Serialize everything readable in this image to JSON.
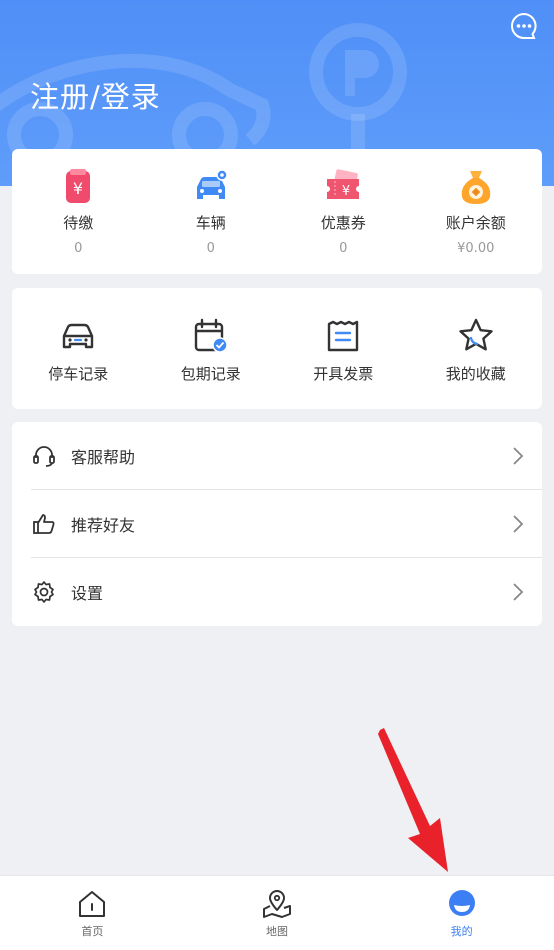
{
  "header": {
    "login_label": "注册/登录"
  },
  "stats": [
    {
      "label": "待缴",
      "value": "0",
      "icon": "pending-bill-icon"
    },
    {
      "label": "车辆",
      "value": "0",
      "icon": "car-location-icon"
    },
    {
      "label": "优惠券",
      "value": "0",
      "icon": "coupon-icon"
    },
    {
      "label": "账户余额",
      "value": "¥0.00",
      "icon": "money-bag-icon"
    }
  ],
  "records": [
    {
      "label": "停车记录",
      "icon": "car-icon"
    },
    {
      "label": "包期记录",
      "icon": "calendar-check-icon"
    },
    {
      "label": "开具发票",
      "icon": "invoice-icon"
    },
    {
      "label": "我的收藏",
      "icon": "star-icon"
    }
  ],
  "menu": [
    {
      "label": "客服帮助",
      "icon": "headset-icon"
    },
    {
      "label": "推荐好友",
      "icon": "thumbs-up-icon"
    },
    {
      "label": "设置",
      "icon": "gear-icon"
    }
  ],
  "tabs": [
    {
      "label": "首页",
      "icon": "home-icon",
      "active": false
    },
    {
      "label": "地图",
      "icon": "map-pin-icon",
      "active": false
    },
    {
      "label": "我的",
      "icon": "profile-icon",
      "active": true
    }
  ],
  "colors": {
    "header_blue": "#4f8ff7",
    "active_tab": "#3c7ff5",
    "annotation_arrow": "#e8212b"
  }
}
